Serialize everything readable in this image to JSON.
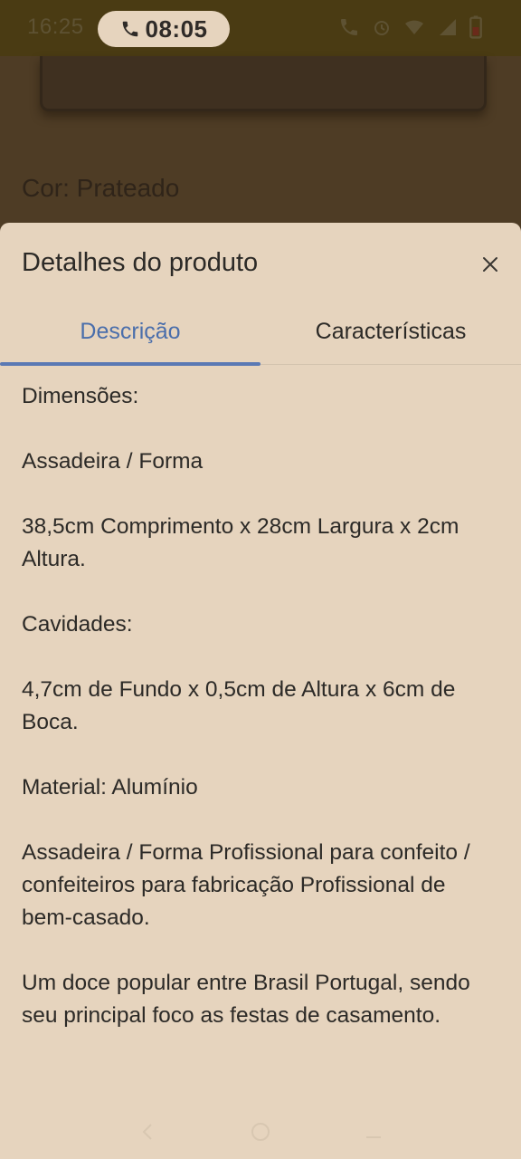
{
  "status_bar": {
    "time": "16:25",
    "call_time": "08:05",
    "icons": [
      "call-icon",
      "alarm-icon",
      "wifi-icon",
      "signal-icon",
      "battery-icon"
    ]
  },
  "background": {
    "color_label": "Cor: Prateado"
  },
  "sheet": {
    "title": "Detalhes do produto",
    "tabs": [
      {
        "label": "Descrição",
        "active": true
      },
      {
        "label": "Características",
        "active": false
      }
    ],
    "paragraphs": [
      "Dimensões:",
      "Assadeira / Forma",
      "38,5cm Comprimento x 28cm Largura x 2cm Altura.",
      "Cavidades:",
      "4,7cm de Fundo x 0,5cm de Altura x 6cm de Boca.",
      "Material: Alumínio",
      "Assadeira / Forma Profissional para confeito / confeiteiros para fabricação Profissional de bem-casado.",
      "Um doce popular entre Brasil Portugal, sendo seu principal foco as festas de casamento."
    ]
  },
  "colors": {
    "accent": "#4a6eab",
    "sheet_bg": "#e6d4be",
    "overlay_bg": "#4b3a24"
  }
}
